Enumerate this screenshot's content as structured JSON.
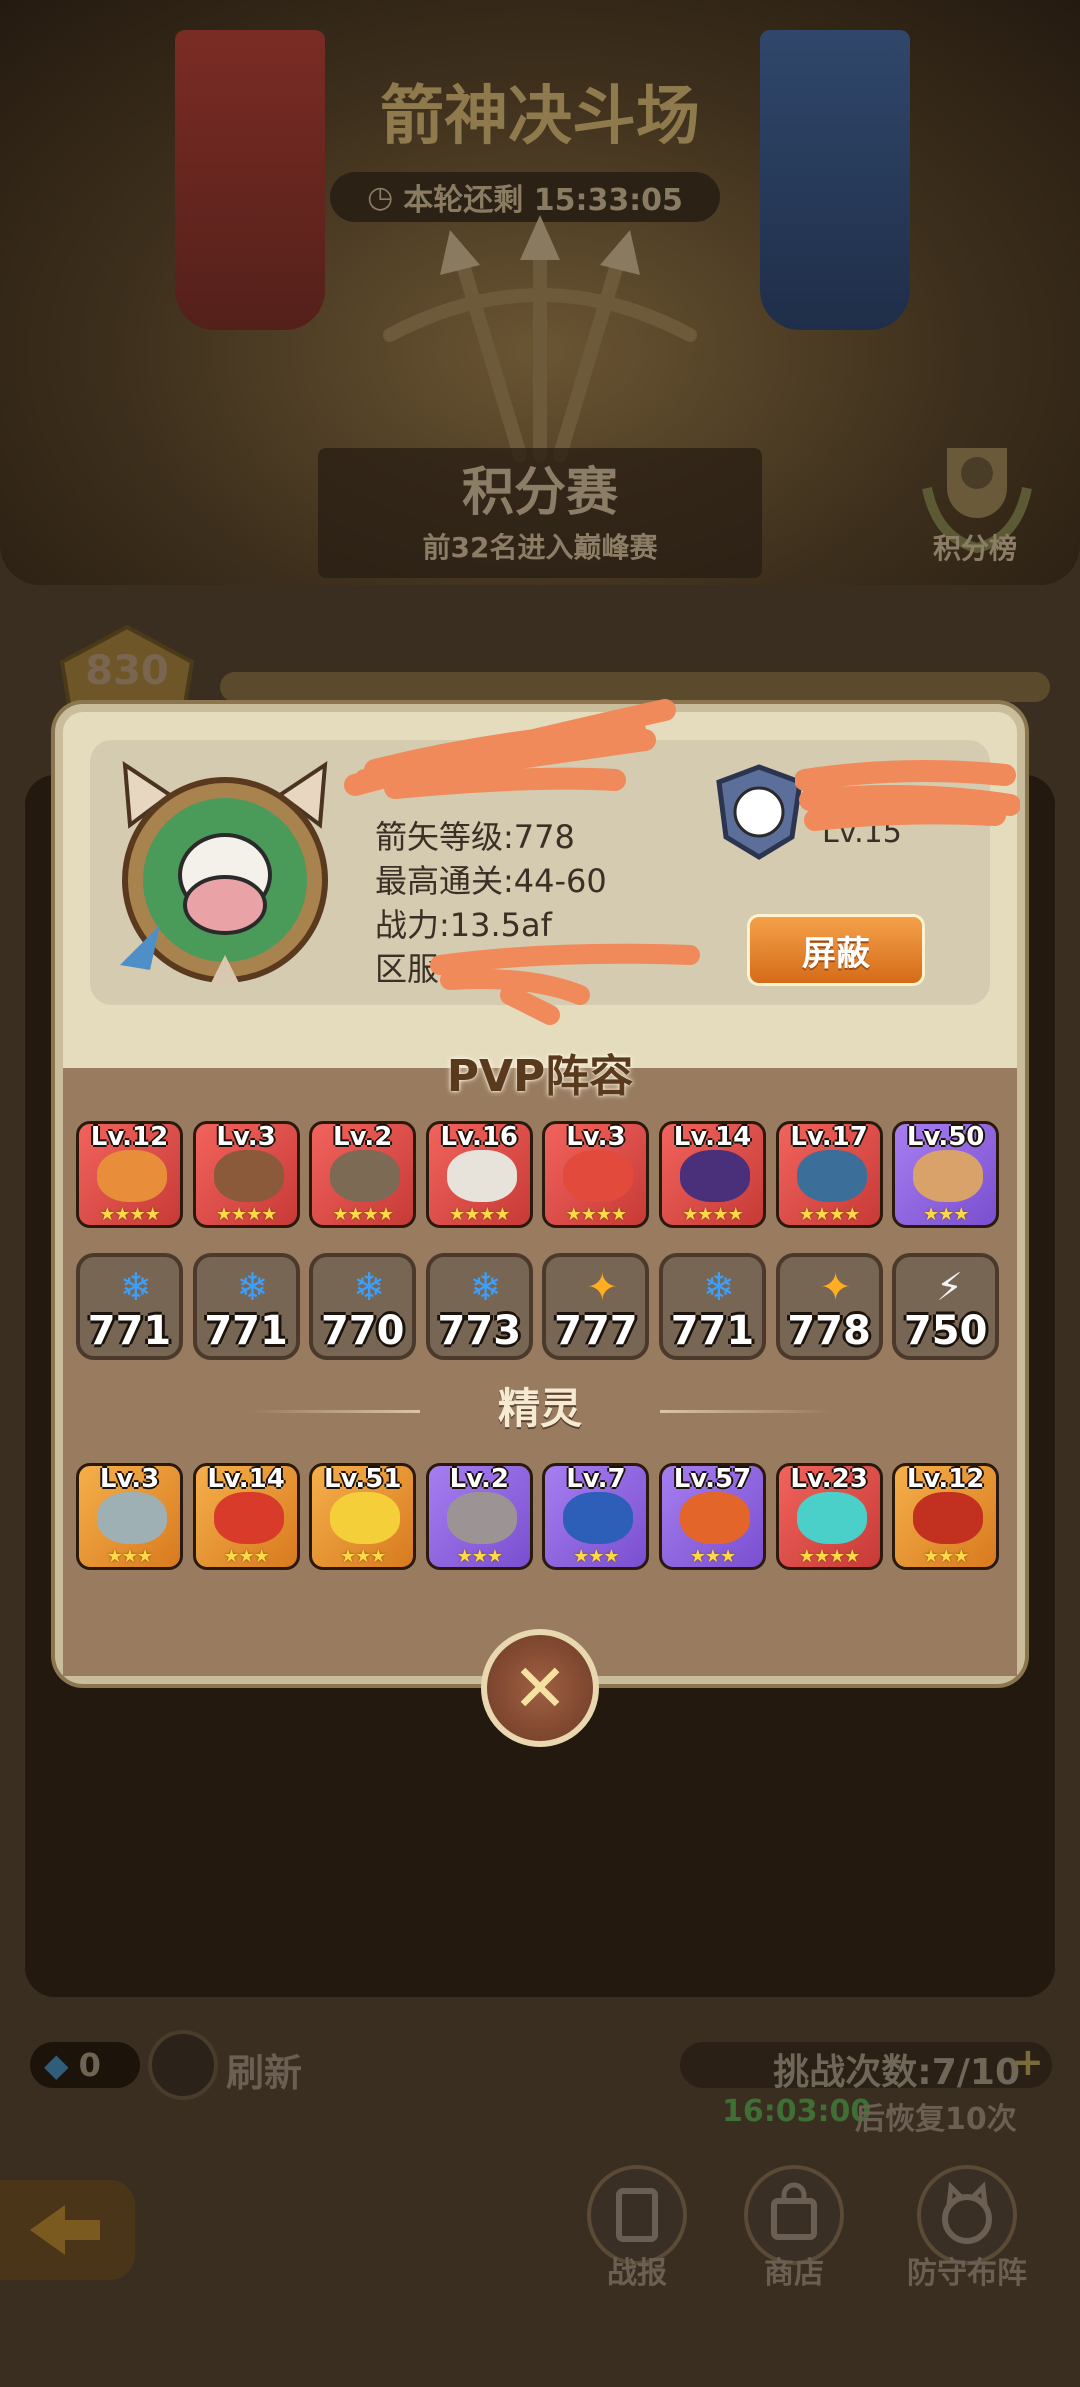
{
  "arena": {
    "title": "箭神决斗场",
    "timer_label": "本轮还剩 15:33:05",
    "mode_title": "积分赛",
    "mode_subtitle": "前32名进入巅峰赛",
    "ranking_label": "积分榜",
    "score": "830"
  },
  "bottom": {
    "gems": "0",
    "refresh_label": "刷新",
    "challenge_label": "挑战次数:7/10",
    "recover_time": "16:03:00",
    "recover_text": "后恢复10次",
    "battle_report": "战报",
    "shop": "商店",
    "defense_lineup": "防守布阵"
  },
  "player": {
    "arrow_level": "箭矢等级:778",
    "best_stage": "最高通关:44-60",
    "power": "战力:13.5af",
    "server_label": "区服",
    "guild_level": "Lv.15",
    "block_button": "屏蔽"
  },
  "lineup": {
    "pvp_title": "PVP阵容",
    "spirit_title": "精灵",
    "heroes": [
      {
        "level": "Lv.12",
        "stars": "★★★★",
        "frame": "red",
        "color": "#e88d3a"
      },
      {
        "level": "Lv.3",
        "stars": "★★★★",
        "frame": "red",
        "color": "#8a5a3a"
      },
      {
        "level": "Lv.2",
        "stars": "★★★★",
        "frame": "red",
        "color": "#7d6a55"
      },
      {
        "level": "Lv.16",
        "stars": "★★★★",
        "frame": "red",
        "color": "#e7e2da"
      },
      {
        "level": "Lv.3",
        "stars": "★★★★",
        "frame": "red",
        "color": "#e24a3c"
      },
      {
        "level": "Lv.14",
        "stars": "★★★★",
        "frame": "red",
        "color": "#4a2f7a"
      },
      {
        "level": "Lv.17",
        "stars": "★★★★",
        "frame": "red",
        "color": "#3b6f9a"
      },
      {
        "level": "Lv.50",
        "stars": "★★★",
        "frame": "purple",
        "color": "#d9a26a"
      }
    ],
    "weapons": [
      {
        "value": "771",
        "element": "ice",
        "color": "#3aa0ff"
      },
      {
        "value": "771",
        "element": "ice",
        "color": "#3aa0ff"
      },
      {
        "value": "770",
        "element": "ice",
        "color": "#3aa0ff"
      },
      {
        "value": "773",
        "element": "ice",
        "color": "#3aa0ff"
      },
      {
        "value": "777",
        "element": "fire",
        "color": "#ffae22"
      },
      {
        "value": "771",
        "element": "ice",
        "color": "#3aa0ff"
      },
      {
        "value": "778",
        "element": "fire",
        "color": "#ffae22"
      },
      {
        "value": "750",
        "element": "lightning",
        "color": "#f2f2f2"
      }
    ],
    "spirits": [
      {
        "level": "Lv.3",
        "stars": "★★★",
        "frame": "orange",
        "color": "#9fb0b5"
      },
      {
        "level": "Lv.14",
        "stars": "★★★",
        "frame": "orange",
        "color": "#d83b2a"
      },
      {
        "level": "Lv.51",
        "stars": "★★★",
        "frame": "orange",
        "color": "#f4cf3a"
      },
      {
        "level": "Lv.2",
        "stars": "★★★",
        "frame": "purple",
        "color": "#9c9494"
      },
      {
        "level": "Lv.7",
        "stars": "★★★",
        "frame": "purple",
        "color": "#2e5fb8"
      },
      {
        "level": "Lv.57",
        "stars": "★★★",
        "frame": "purple",
        "color": "#e4652a"
      },
      {
        "level": "Lv.23",
        "stars": "★★★★",
        "frame": "red",
        "color": "#4ad0c8"
      },
      {
        "level": "Lv.12",
        "stars": "★★★",
        "frame": "orange",
        "color": "#c2301f"
      }
    ]
  }
}
